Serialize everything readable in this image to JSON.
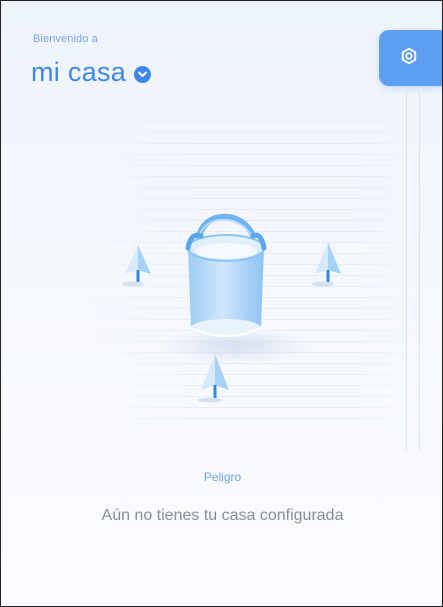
{
  "header": {
    "welcome_text": "Bienvenido a",
    "home_name": "mi casa",
    "dropdown_icon": "chevron-down-icon",
    "settings_icon": "gear-icon"
  },
  "empty_state": {
    "status_label": "Peligro",
    "message": "Aún no tienes tu casa configurada"
  },
  "colors": {
    "accent": "#3f86ee",
    "settings_button": "#5e9ff2",
    "message_text": "#8a8f96",
    "background_top": "#eef4fc"
  }
}
